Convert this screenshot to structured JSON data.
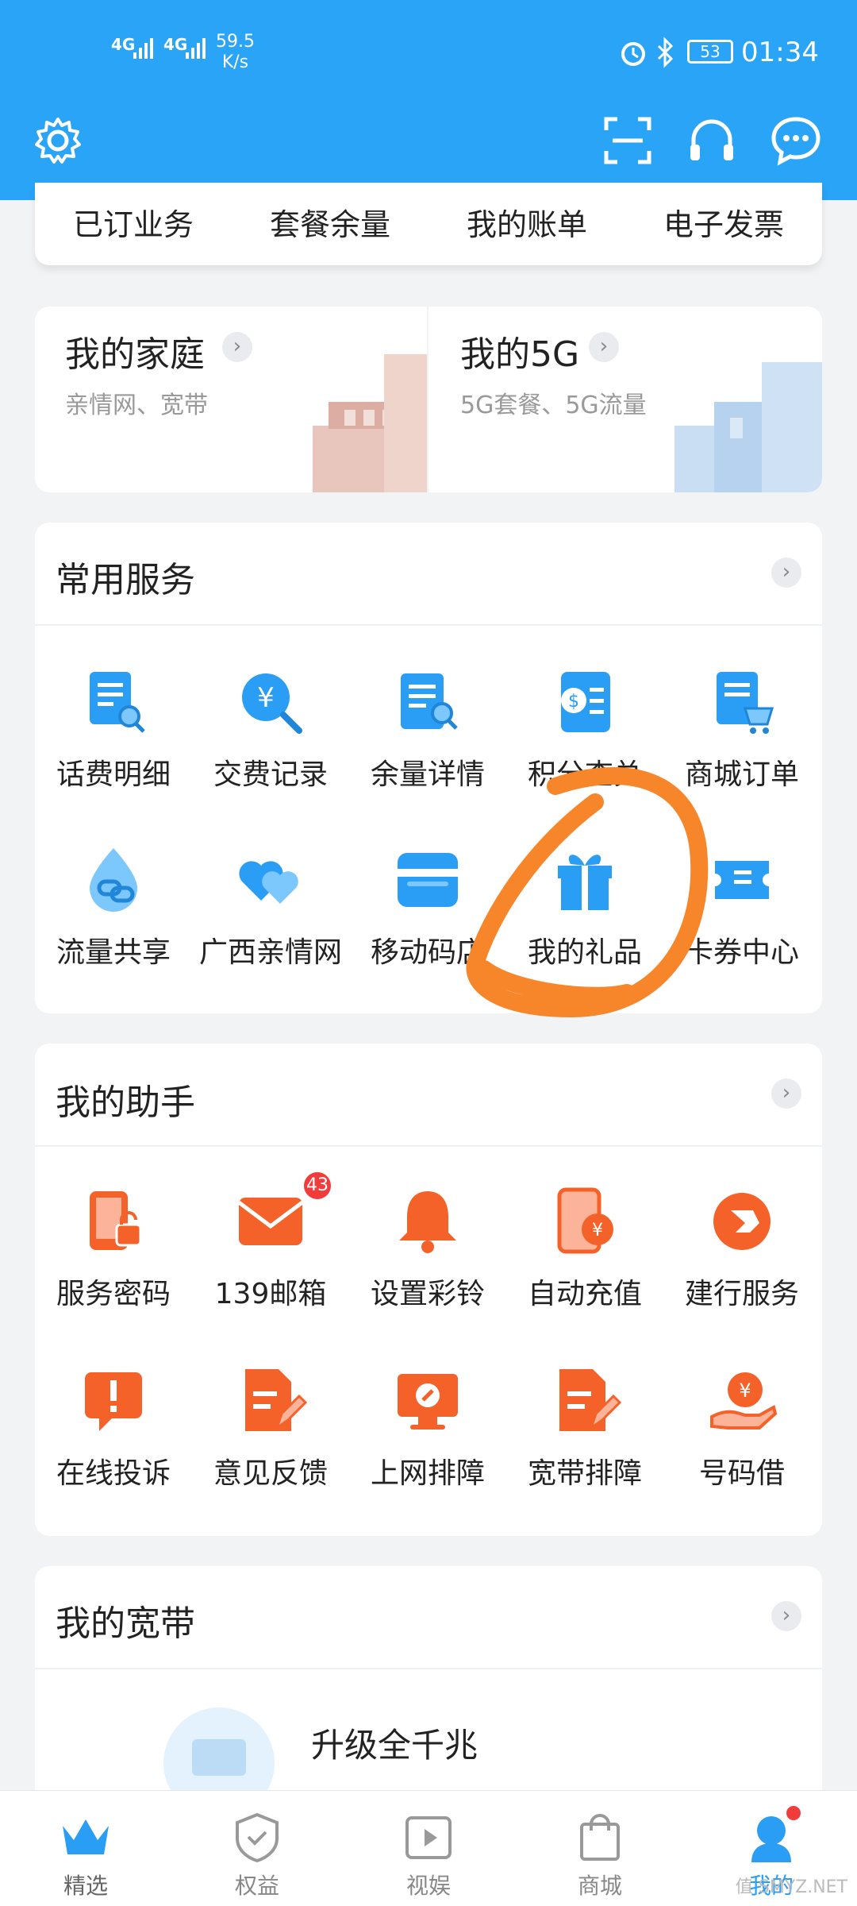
{
  "status": {
    "sig1": "4G",
    "sig2": "4G",
    "speed_value": "59.5",
    "speed_unit": "K/s",
    "battery": "53",
    "time": "01:34"
  },
  "header_icons": [
    "gear-icon",
    "scan-icon",
    "headset-icon",
    "chat-icon"
  ],
  "quick_links": [
    "已订业务",
    "套餐余量",
    "我的账单",
    "电子发票"
  ],
  "promo": {
    "family": {
      "title": "我的家庭",
      "subtitle": "亲情网、宽带"
    },
    "fiveg": {
      "title": "我的5G",
      "subtitle": "5G套餐、5G流量"
    }
  },
  "common_services": {
    "title": "常用服务",
    "items": [
      "话费明细",
      "交费记录",
      "余量详情",
      "积分查兑",
      "商城订单",
      "流量共享",
      "广西亲情网",
      "移动码店",
      "我的礼品",
      "卡券中心"
    ]
  },
  "assistant": {
    "title": "我的助手",
    "mail_badge": "43",
    "items": [
      "服务密码",
      "139邮箱",
      "设置彩铃",
      "自动充值",
      "建行服务",
      "在线投诉",
      "意见反馈",
      "上网排障",
      "宽带排障",
      "号码借"
    ]
  },
  "broadband": {
    "title": "我的宽带",
    "upgrade": "升级全千兆"
  },
  "tabs": [
    "精选",
    "权益",
    "视娱",
    "商城",
    "我的"
  ],
  "watermark": "值 SMYZ.NET",
  "colors": {
    "header": "#2aa4f7",
    "service_blue": "#2a9df4",
    "assistant_orange": "#f4622a",
    "highlight_circle": "#f7862a"
  }
}
